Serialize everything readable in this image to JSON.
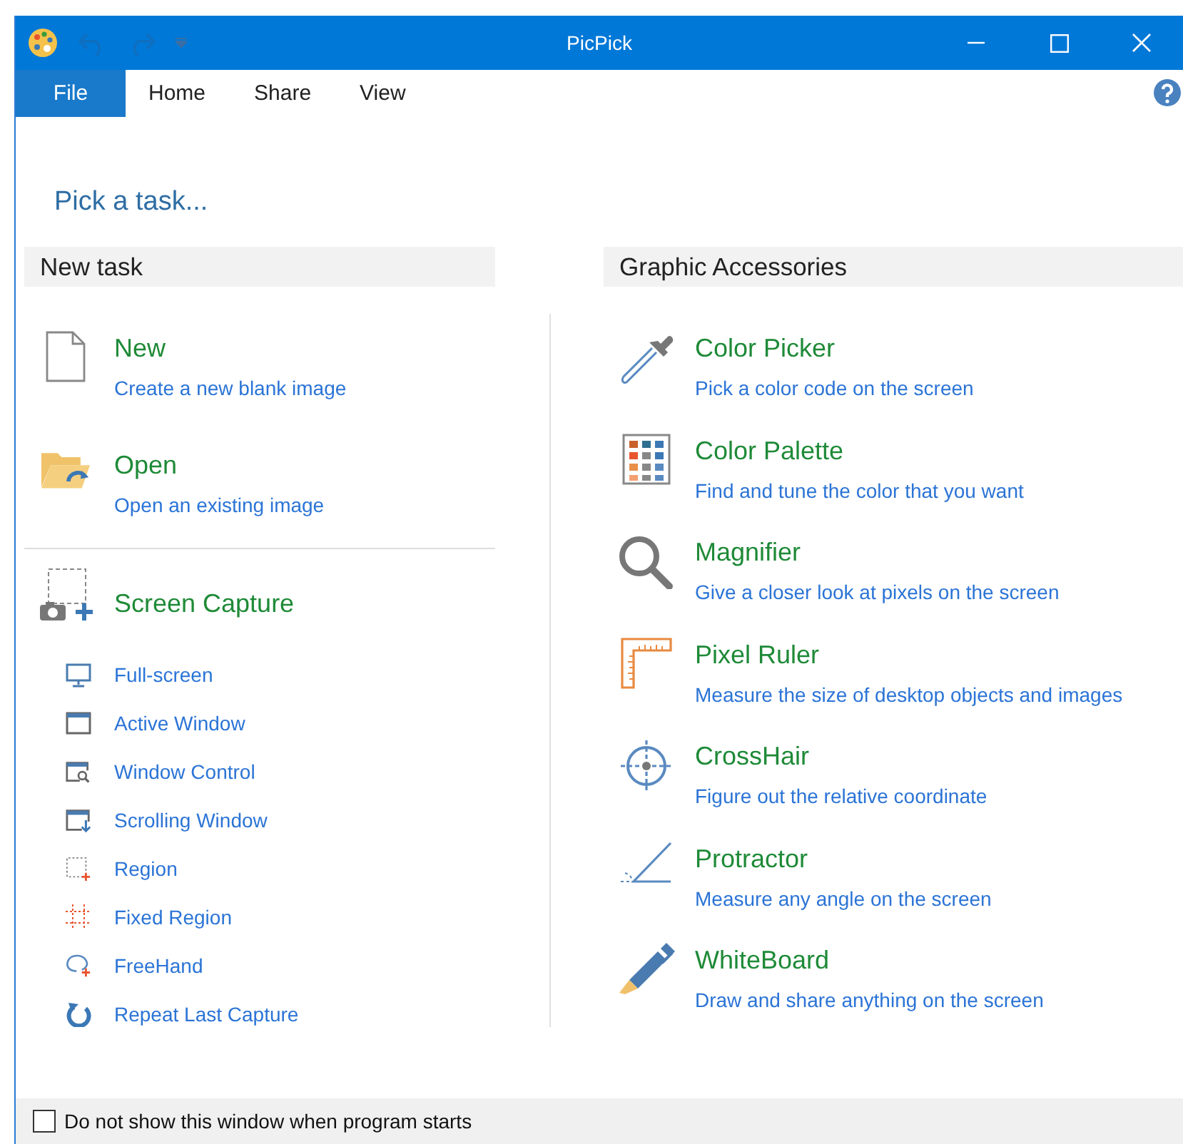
{
  "window": {
    "title": "PicPick"
  },
  "tabs": [
    {
      "label": "File",
      "kind": "menu"
    },
    {
      "label": "Home",
      "kind": "tab"
    },
    {
      "label": "Share",
      "kind": "tab"
    },
    {
      "label": "View",
      "kind": "tab"
    }
  ],
  "heading": "Pick a task...",
  "new_task": {
    "title": "New task",
    "items": [
      {
        "title": "New",
        "description": "Create a new blank image"
      },
      {
        "title": "Open",
        "description": "Open an existing image"
      }
    ],
    "screen_capture": {
      "title": "Screen Capture",
      "items": [
        "Full-screen",
        "Active Window",
        "Window Control",
        "Scrolling Window",
        "Region",
        "Fixed Region",
        "FreeHand",
        "Repeat Last Capture"
      ]
    }
  },
  "graphic_accessories": {
    "title": "Graphic Accessories",
    "items": [
      {
        "title": "Color Picker",
        "description": "Pick a color code on the screen"
      },
      {
        "title": "Color Palette",
        "description": "Find and tune the color that you want"
      },
      {
        "title": "Magnifier",
        "description": "Give a closer look at pixels on the screen"
      },
      {
        "title": "Pixel Ruler",
        "description": "Measure the size of desktop objects and images"
      },
      {
        "title": "CrossHair",
        "description": "Figure out the relative coordinate"
      },
      {
        "title": "Protractor",
        "description": "Measure any angle on the screen"
      },
      {
        "title": "WhiteBoard",
        "description": "Draw and share anything on the screen"
      }
    ]
  },
  "footer": {
    "checkbox": {
      "label": "Do not show this window when program starts",
      "checked": false
    }
  }
}
